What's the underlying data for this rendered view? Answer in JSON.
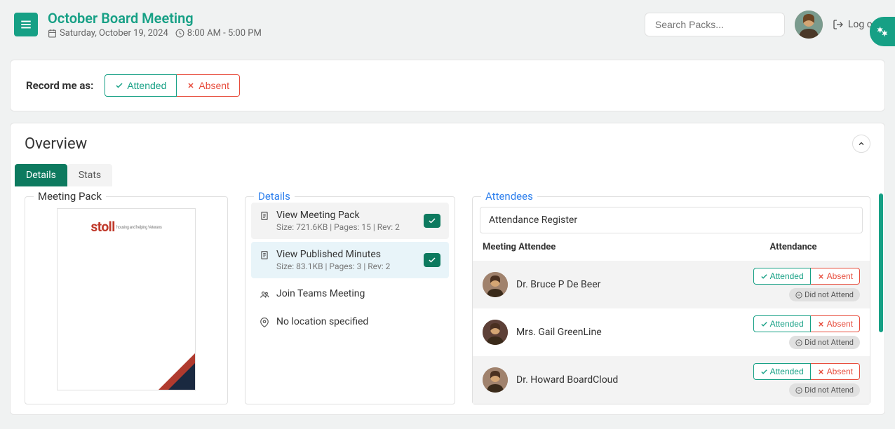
{
  "header": {
    "meeting_title": "October Board Meeting",
    "meeting_date": "Saturday, October 19, 2024",
    "meeting_time": "8:00 AM - 5:00 PM",
    "search_placeholder": "Search Packs...",
    "logout_label": "Log out"
  },
  "record": {
    "label": "Record me as:",
    "attended_label": "Attended",
    "absent_label": "Absent"
  },
  "overview": {
    "title": "Overview",
    "tabs": {
      "details": "Details",
      "stats": "Stats"
    },
    "meeting_pack": {
      "legend": "Meeting Pack",
      "logo_text": "stoll",
      "logo_tagline": "housing and helping Veterans"
    },
    "details": {
      "legend": "Details",
      "items": [
        {
          "title": "View Meeting Pack",
          "sub": "Size: 721.6KB | Pages: 15 | Rev: 2",
          "icon": "document-icon",
          "checked": true,
          "bg": "gray"
        },
        {
          "title": "View Published Minutes",
          "sub": "Size: 83.1KB | Pages: 3 | Rev: 2",
          "icon": "document-icon",
          "checked": true,
          "bg": "blue"
        },
        {
          "title": "Join Teams Meeting",
          "sub": "",
          "icon": "people-icon",
          "checked": false,
          "bg": "none"
        },
        {
          "title": "No location specified",
          "sub": "",
          "icon": "location-icon",
          "checked": false,
          "bg": "none"
        }
      ]
    },
    "attendees": {
      "legend": "Attendees",
      "register_label": "Attendance Register",
      "header_name": "Meeting Attendee",
      "header_attendance": "Attendance",
      "attended_label": "Attended",
      "absent_label": "Absent",
      "dna_label": "Did not Attend",
      "list": [
        {
          "name": "Dr. Bruce P De Beer",
          "alt": true,
          "avatar_bg": "#a0826d"
        },
        {
          "name": "Mrs. Gail GreenLine",
          "alt": false,
          "avatar_bg": "#5d4037"
        },
        {
          "name": "Dr. Howard BoardCloud",
          "alt": true,
          "avatar_bg": "#a0826d"
        }
      ]
    }
  }
}
